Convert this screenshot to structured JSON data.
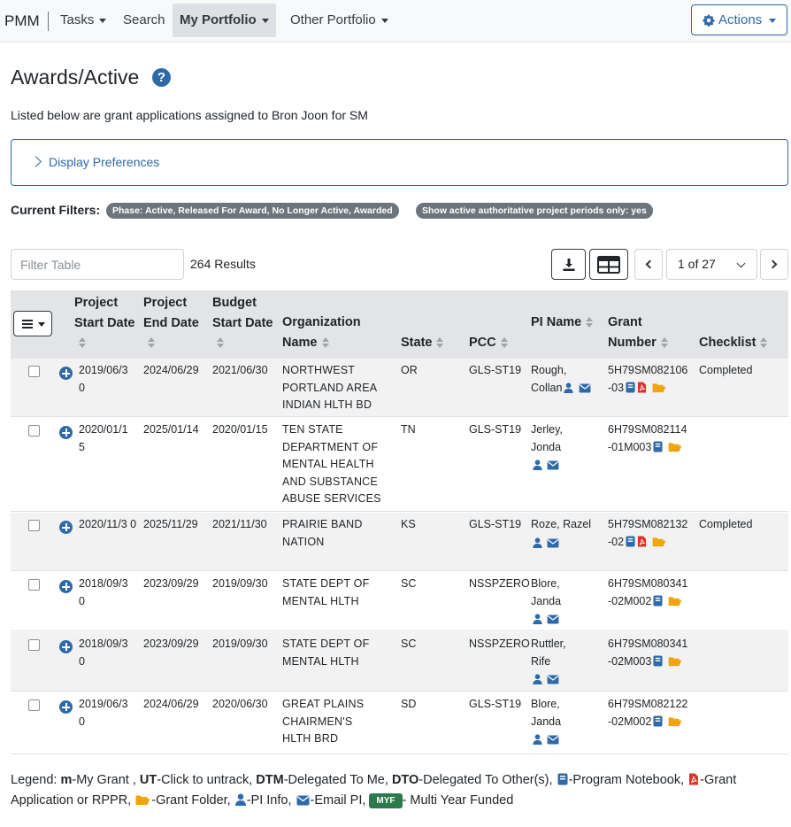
{
  "nav": {
    "brand": "PMM",
    "items": [
      {
        "label": "Tasks",
        "dropdown": true
      },
      {
        "label": "Search",
        "dropdown": false
      },
      {
        "label": "My Portfolio",
        "dropdown": true,
        "active": true
      },
      {
        "label": "Other Portfolio",
        "dropdown": true
      }
    ],
    "actions_label": "Actions"
  },
  "header": {
    "title": "Awards/Active",
    "subtitle": "Listed below are grant applications assigned to Bron Joon for SM",
    "prefs_label": "Display Preferences",
    "filters_label": "Current Filters:",
    "filter_badges": [
      "Phase: Active, Released For Award, No Longer Active, Awarded",
      "Show active authoritative project periods only: yes"
    ]
  },
  "toolbar": {
    "filter_placeholder": "Filter Table",
    "results": "264 Results",
    "page": "1 of 27"
  },
  "table": {
    "columns": [
      "Project Start Date",
      "Project End Date",
      "Budget Start Date",
      "Organization Name",
      "State",
      "PCC",
      "PI Name",
      "Grant Number",
      "Checklist"
    ],
    "rows": [
      {
        "start": "2019/06/3 0",
        "end": "2024/06/29",
        "budget": "2021/06/30",
        "org": [
          "NORTHWEST",
          "PORTLAND AREA",
          "INDIAN HLTH BD"
        ],
        "state": "OR",
        "pcc": "GLS-ST19",
        "pi": [
          "Rough,",
          "Collan"
        ],
        "grant": [
          "5H79SM082106",
          "-03"
        ],
        "pdf": true,
        "checklist": "Completed"
      },
      {
        "start": "2020/01/1 5",
        "end": "2025/01/14",
        "budget": "2020/01/15",
        "org": [
          "TEN  STATE",
          "DEPARTMENT OF",
          "MENTAL HEALTH",
          "AND SUBSTANCE",
          "ABUSE SERVICES"
        ],
        "state": "TN",
        "pcc": "GLS-ST19",
        "pi": [
          "Jerley,",
          "Jonda"
        ],
        "grant": [
          "6H79SM082114",
          "-01M003"
        ],
        "pdf": false,
        "checklist": ""
      },
      {
        "start": "2020/11/3 0",
        "end": "2025/11/29",
        "budget": "2021/11/30",
        "org": [
          "PRAIRIE BAND",
          "NATION"
        ],
        "state": "KS",
        "pcc": "GLS-ST19",
        "pi": [
          "Roze,  Razel"
        ],
        "grant": [
          "5H79SM082132",
          "-02"
        ],
        "pdf": true,
        "checklist": "Completed"
      },
      {
        "start": "2018/09/3 0",
        "end": "2023/09/29",
        "budget": "2019/09/30",
        "org": [
          "STATE DEPT OF",
          "MENTAL HLTH"
        ],
        "state": "SC",
        "pcc": "NSSPZERO",
        "pi": [
          "Blore,",
          "Janda"
        ],
        "grant": [
          "6H79SM080341",
          "-02M002"
        ],
        "pdf": false,
        "checklist": ""
      },
      {
        "start": "2018/09/3 0",
        "end": "2023/09/29",
        "budget": "2019/09/30",
        "org": [
          "STATE DEPT OF",
          "MENTAL HLTH"
        ],
        "state": "SC",
        "pcc": "NSSPZERO",
        "pi": [
          "Ruttler,",
          "Rife"
        ],
        "grant": [
          "6H79SM080341",
          "-02M003"
        ],
        "pdf": false,
        "checklist": ""
      },
      {
        "start": "2019/06/3 0",
        "end": "2024/06/29",
        "budget": "2020/06/30",
        "org": [
          "GREAT PLAINS",
          "CHAIRMEN'S",
          "HLTH BRD"
        ],
        "state": "SD",
        "pcc": "GLS-ST19",
        "pi": [
          "Blore,",
          "Janda"
        ],
        "grant": [
          "6H79SM082122",
          "-02M002"
        ],
        "pdf": false,
        "checklist": ""
      }
    ]
  },
  "legend": {
    "prefix": "Legend:",
    "m": "m",
    "m_text": "-My Grant ,",
    "ut": "UT",
    "ut_text": "-Click to untrack,",
    "dtm": "DTM",
    "dtm_text": "-Delegated To Me,",
    "dto": "DTO",
    "dto_text": "-Delegated To Other(s),",
    "notebook": "-Program Notebook,",
    "pdf": "-Grant",
    "pdf2": "Application or RPPR,",
    "folder": "-Grant Folder,",
    "pi": "-PI Info,",
    "email": "-Email PI,",
    "myf": "MYF",
    "myf_text": "- Multi Year Funded"
  },
  "colors": {
    "link": "#2e6aa9",
    "pdf": "#d9342b",
    "folder": "#f0a30a",
    "myf": "#2a7a4b",
    "badge": "#6c757d"
  }
}
